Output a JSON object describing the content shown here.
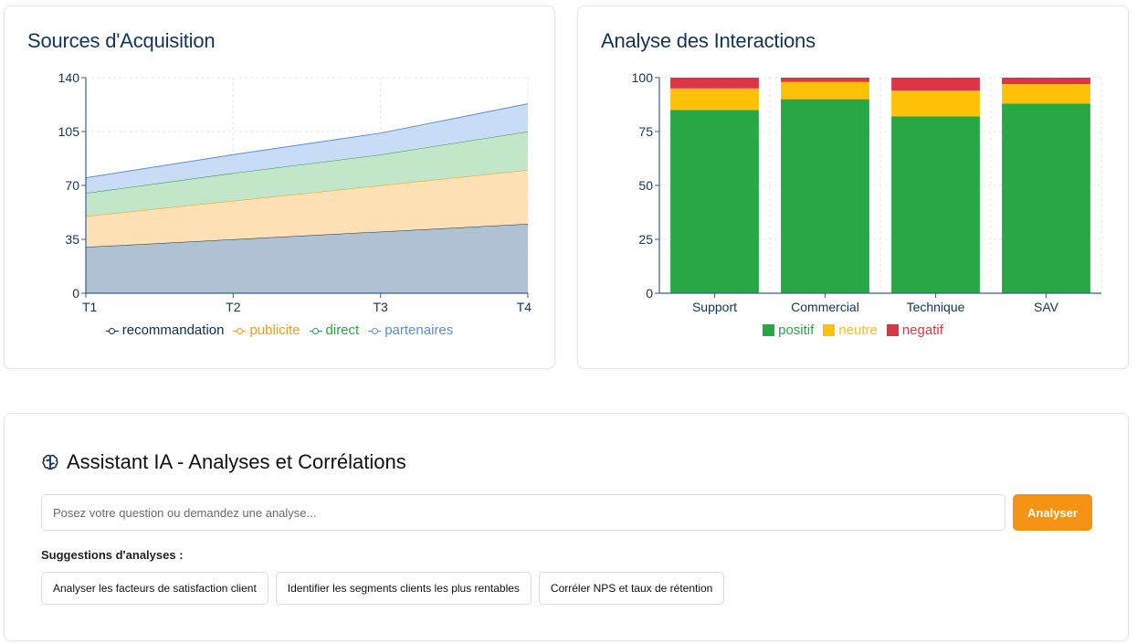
{
  "acquisition": {
    "title": "Sources d'Acquisition",
    "chart_data": {
      "type": "area",
      "stacked": true,
      "categories": [
        "T1",
        "T2",
        "T3",
        "T4"
      ],
      "ylim": [
        0,
        140
      ],
      "yticks": [
        0,
        35,
        70,
        105,
        140
      ],
      "grid": true,
      "legend_position": "bottom",
      "series": [
        {
          "name": "recommandation",
          "values": [
            30,
            35,
            40,
            45
          ],
          "color": "#0c2f55",
          "fill": "#b0c1d3"
        },
        {
          "name": "publicite",
          "values": [
            20,
            25,
            30,
            35
          ],
          "color": "#f39c12",
          "fill": "#fde0b3"
        },
        {
          "name": "direct",
          "values": [
            15,
            18,
            20,
            25
          ],
          "color": "#2ea043",
          "fill": "#c1e6c8"
        },
        {
          "name": "partenaires",
          "values": [
            10,
            12,
            14,
            18
          ],
          "color": "#5b8fd6",
          "fill": "#c9dcf5"
        }
      ]
    }
  },
  "interactions": {
    "title": "Analyse des Interactions",
    "chart_data": {
      "type": "bar",
      "stacked": true,
      "categories": [
        "Support",
        "Commercial",
        "Technique",
        "SAV"
      ],
      "ylim": [
        0,
        100
      ],
      "yticks": [
        0,
        25,
        50,
        75,
        100
      ],
      "grid": true,
      "legend_position": "bottom",
      "series": [
        {
          "name": "positif",
          "values": [
            85,
            90,
            82,
            88
          ],
          "color": "#28a745"
        },
        {
          "name": "neutre",
          "values": [
            10,
            8,
            12,
            9
          ],
          "color": "#ffc107"
        },
        {
          "name": "negatif",
          "values": [
            5,
            2,
            6,
            3
          ],
          "color": "#dc3545"
        }
      ]
    }
  },
  "assistant": {
    "title": "Assistant IA - Analyses et Corrélations",
    "icon": "brain-icon",
    "input_placeholder": "Posez votre question ou demandez une analyse...",
    "input_value": "",
    "analyze_label": "Analyser",
    "accent_color": "#f59314",
    "suggestions_label": "Suggestions d'analyses :",
    "suggestions": [
      "Analyser les facteurs de satisfaction client",
      "Identifier les segments clients les plus rentables",
      "Corréler NPS et taux de rétention"
    ]
  }
}
